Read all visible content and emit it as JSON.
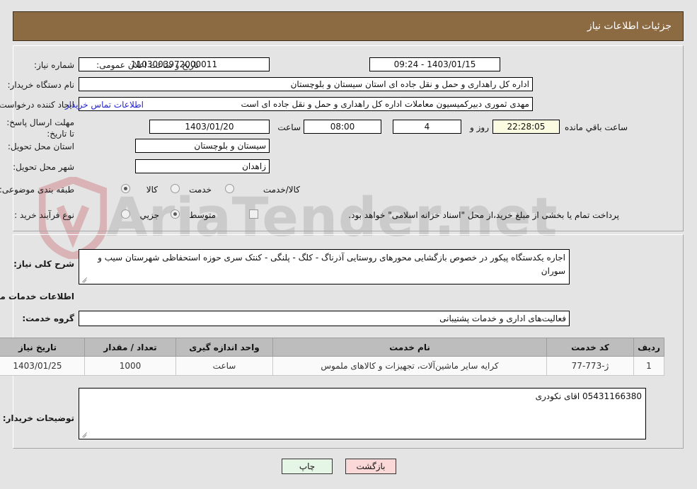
{
  "header": {
    "title": "جزئیات اطلاعات نیاز"
  },
  "top_form": {
    "need_number_label": "شماره نیاز:",
    "need_number_value": "1103003972000011",
    "announce_datetime_label": "تاریخ و ساعت اعلان عمومی:",
    "announce_datetime_value": "1403/01/15 - 09:24",
    "buyer_org_label": "نام دستگاه خریدار:",
    "buyer_org_value": "اداره کل راهداری و حمل و نقل جاده ای استان سیستان و بلوچستان",
    "requester_label": "ایجاد کننده درخواست:",
    "requester_value": "مهدی ثموری دبیرکمیسیون معاملات اداره کل راهداری و حمل و نقل جاده ای است",
    "contact_link": "اطلاعات تماس خریدار",
    "deadline_label": "مهلت ارسال پاسخ: تا تاریخ:",
    "deadline_date": "1403/01/20",
    "deadline_hour_label": "ساعت",
    "deadline_hour": "08:00",
    "days_value": "4",
    "days_label": "روز و",
    "countdown": "22:28:05",
    "countdown_label": "ساعت باقي مانده",
    "province_label": "استان محل تحویل:",
    "province_value": "سیستان و بلوچستان",
    "city_label": "شهر محل تحویل:",
    "city_value": "زاهدان",
    "category_label": "طبقه بندی موضوعی:",
    "category_options": [
      {
        "label": "کالا",
        "selected": false
      },
      {
        "label": "خدمت",
        "selected": true
      },
      {
        "label": "کالا/خدمت",
        "selected": false
      }
    ],
    "process_label": "نوع فرآیند خرید :",
    "process_options": [
      {
        "label": "جزیي",
        "selected": false
      },
      {
        "label": "متوسط",
        "selected": true
      }
    ],
    "treasury_checkbox_checked": false,
    "treasury_note": "پرداخت تمام یا بخشی از مبلغ خرید،از محل \"اسناد خزانه اسلامی\" خواهد بود."
  },
  "description": {
    "label": "شرح کلی نیاز:",
    "value": "اجاره یکدستگاه پیکور در خصوص بازگشایی محورهای روستایی آذرناگ - کلگ - پلنگی - کنتک سری حوزه استحفاظی شهرستان سیب و سوران"
  },
  "services_section": {
    "heading": "اطلاعات خدمات مورد نیاز",
    "group_label": "گروه خدمت:",
    "group_value": "فعالیت‌های اداری و خدمات پشتیبانی"
  },
  "table": {
    "columns": [
      "ردیف",
      "کد خدمت",
      "نام خدمت",
      "واحد اندازه گیری",
      "تعداد / مقدار",
      "تاریخ نیاز"
    ],
    "rows": [
      {
        "row": "1",
        "code": "ژ-773-77",
        "name": "کرایه سایر ماشین‌آلات، تجهیزات و کالاهای ملموس",
        "unit": "ساعت",
        "qty": "1000",
        "date": "1403/01/25"
      }
    ]
  },
  "buyer_notes": {
    "label": "توضیحات خریدار:",
    "value": "05431166380 اقای نکودری"
  },
  "footer": {
    "print_label": "چاپ",
    "back_label": "بازگشت"
  },
  "watermark": {
    "text": "AriaTender.net"
  },
  "colors": {
    "header_bg": "#8c6b42",
    "page_bg": "#e4e4e4",
    "link": "#2424d0",
    "table_header_bg": "#bdbdbd",
    "print_btn_bg": "#e6f6e6",
    "back_btn_bg": "#fbd8d8",
    "countdown_bg": "#fbfbe2"
  }
}
